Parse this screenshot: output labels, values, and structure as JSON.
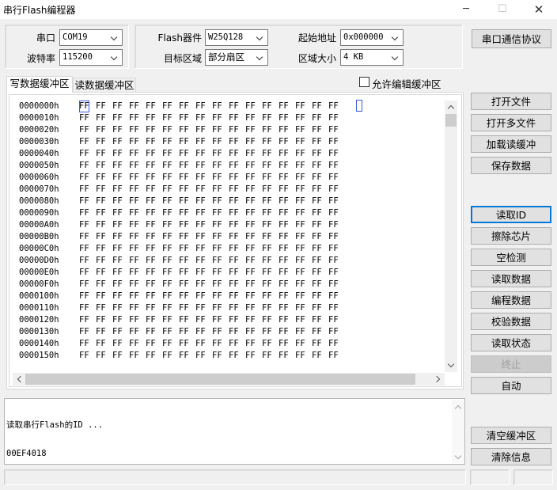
{
  "window": {
    "title": "串行Flash编程器",
    "minimize": "─",
    "maximize": "☐",
    "close": "✕"
  },
  "port_group": {
    "port_label": "串口",
    "port_value": "COM19",
    "baud_label": "波特率",
    "baud_value": "115200"
  },
  "flash_group": {
    "device_label": "Flash器件",
    "device_value": "W25Q128",
    "target_label": "目标区域",
    "target_value": "部分扇区",
    "start_label": "起始地址",
    "start_value": "0x000000",
    "size_label": "区域大小",
    "size_value": "4 KB"
  },
  "protocol_button": "串口通信协议",
  "tabs": [
    "写数据缓冲区",
    "读数据缓冲区"
  ],
  "allow_edit": {
    "label": "允许编辑缓冲区",
    "checked": false
  },
  "hex": {
    "addresses": [
      "0000000h",
      "0000010h",
      "0000020h",
      "0000030h",
      "0000040h",
      "0000050h",
      "0000060h",
      "0000070h",
      "0000080h",
      "0000090h",
      "00000A0h",
      "00000B0h",
      "00000C0h",
      "00000D0h",
      "00000E0h",
      "00000F0h",
      "0000100h",
      "0000110h",
      "0000120h",
      "0000130h",
      "0000140h",
      "0000150h"
    ],
    "byte_value": "FF",
    "bytes_per_row": 16,
    "selected_byte": "0000000h:0"
  },
  "buttons": {
    "open_file": "打开文件",
    "open_multi": "打开多文件",
    "load_read_buffer": "加载读缓冲",
    "save_data": "保存数据",
    "read_id": "读取ID",
    "erase_chip": "擦除芯片",
    "blank_check": "空检测",
    "read_data": "读取数据",
    "program_data": "编程数据",
    "verify_data": "校验数据",
    "read_status": "读取状态",
    "abort": "终止",
    "auto": "自动",
    "clear_buffer": "清空缓冲区",
    "clear_info": "清除信息"
  },
  "log": {
    "lines": [
      "读取串行Flash的ID ...",
      "00EF4018"
    ]
  },
  "colors": {
    "accent": "#0078d7",
    "selection": "#3b5bdb"
  }
}
